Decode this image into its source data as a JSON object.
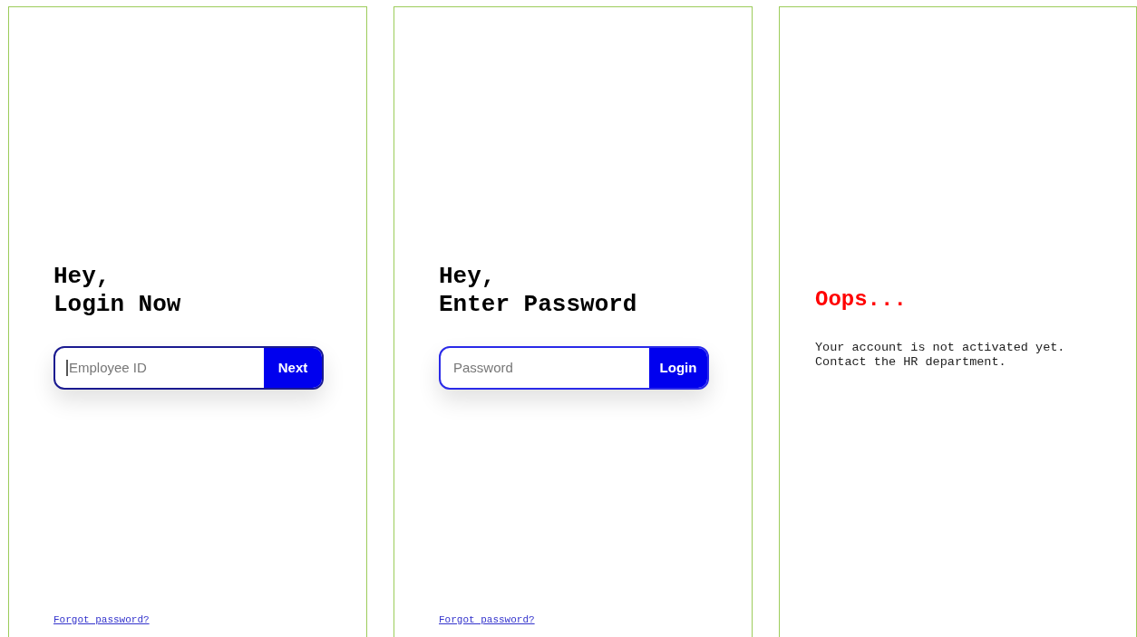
{
  "panels": [
    {
      "kind": "login",
      "heading": [
        "Hey,",
        "Login Now"
      ],
      "field": {
        "placeholder": "Employee ID",
        "focused": true
      },
      "button": "Next",
      "link": "Forgot password?"
    },
    {
      "kind": "login",
      "heading": [
        "Hey,",
        "Enter Password"
      ],
      "field": {
        "placeholder": "Password",
        "focused": false
      },
      "button": "Login",
      "link": "Forgot password?"
    },
    {
      "kind": "message",
      "title": "Oops...",
      "lines": [
        "Your account is not activated yet.",
        "Contact the HR department."
      ]
    }
  ]
}
